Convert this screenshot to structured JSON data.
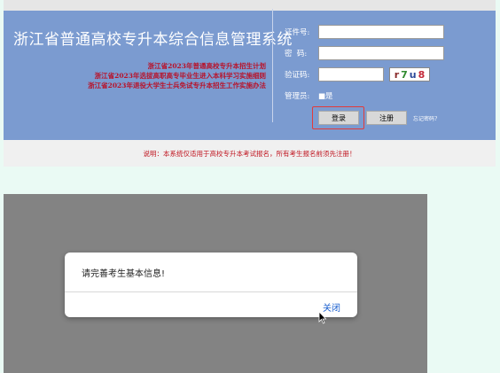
{
  "header": {
    "title": "浙江省普通高校专升本综合信息管理系统",
    "links": [
      "浙江省2023年普通高校专升本招生计划",
      "浙江省2023年选拔高职高专毕业生进入本科学习实施细则",
      "浙江省2023年退役大学生士兵免试专升本招生工作实施办法"
    ]
  },
  "login": {
    "id_label": "证件号:",
    "password_label": "密  码:",
    "captcha_label": "验证码:",
    "captcha_chars": [
      "r",
      "7",
      "u",
      "8"
    ],
    "captcha_colors": [
      "#8a2c2c",
      "#2f8a2f",
      "#2c4a9a",
      "#c42a3a"
    ],
    "admin_label": "管理员:",
    "admin_option": "■是",
    "login_button": "登录",
    "register_button": "注册",
    "forgot_link": "忘记密码?"
  },
  "notice": "说明：本系统仅适用于高校专升本考试报名，所有考生报名前须先注册！",
  "dialog": {
    "message": "请完善考生基本信息!",
    "close_button": "关闭"
  }
}
